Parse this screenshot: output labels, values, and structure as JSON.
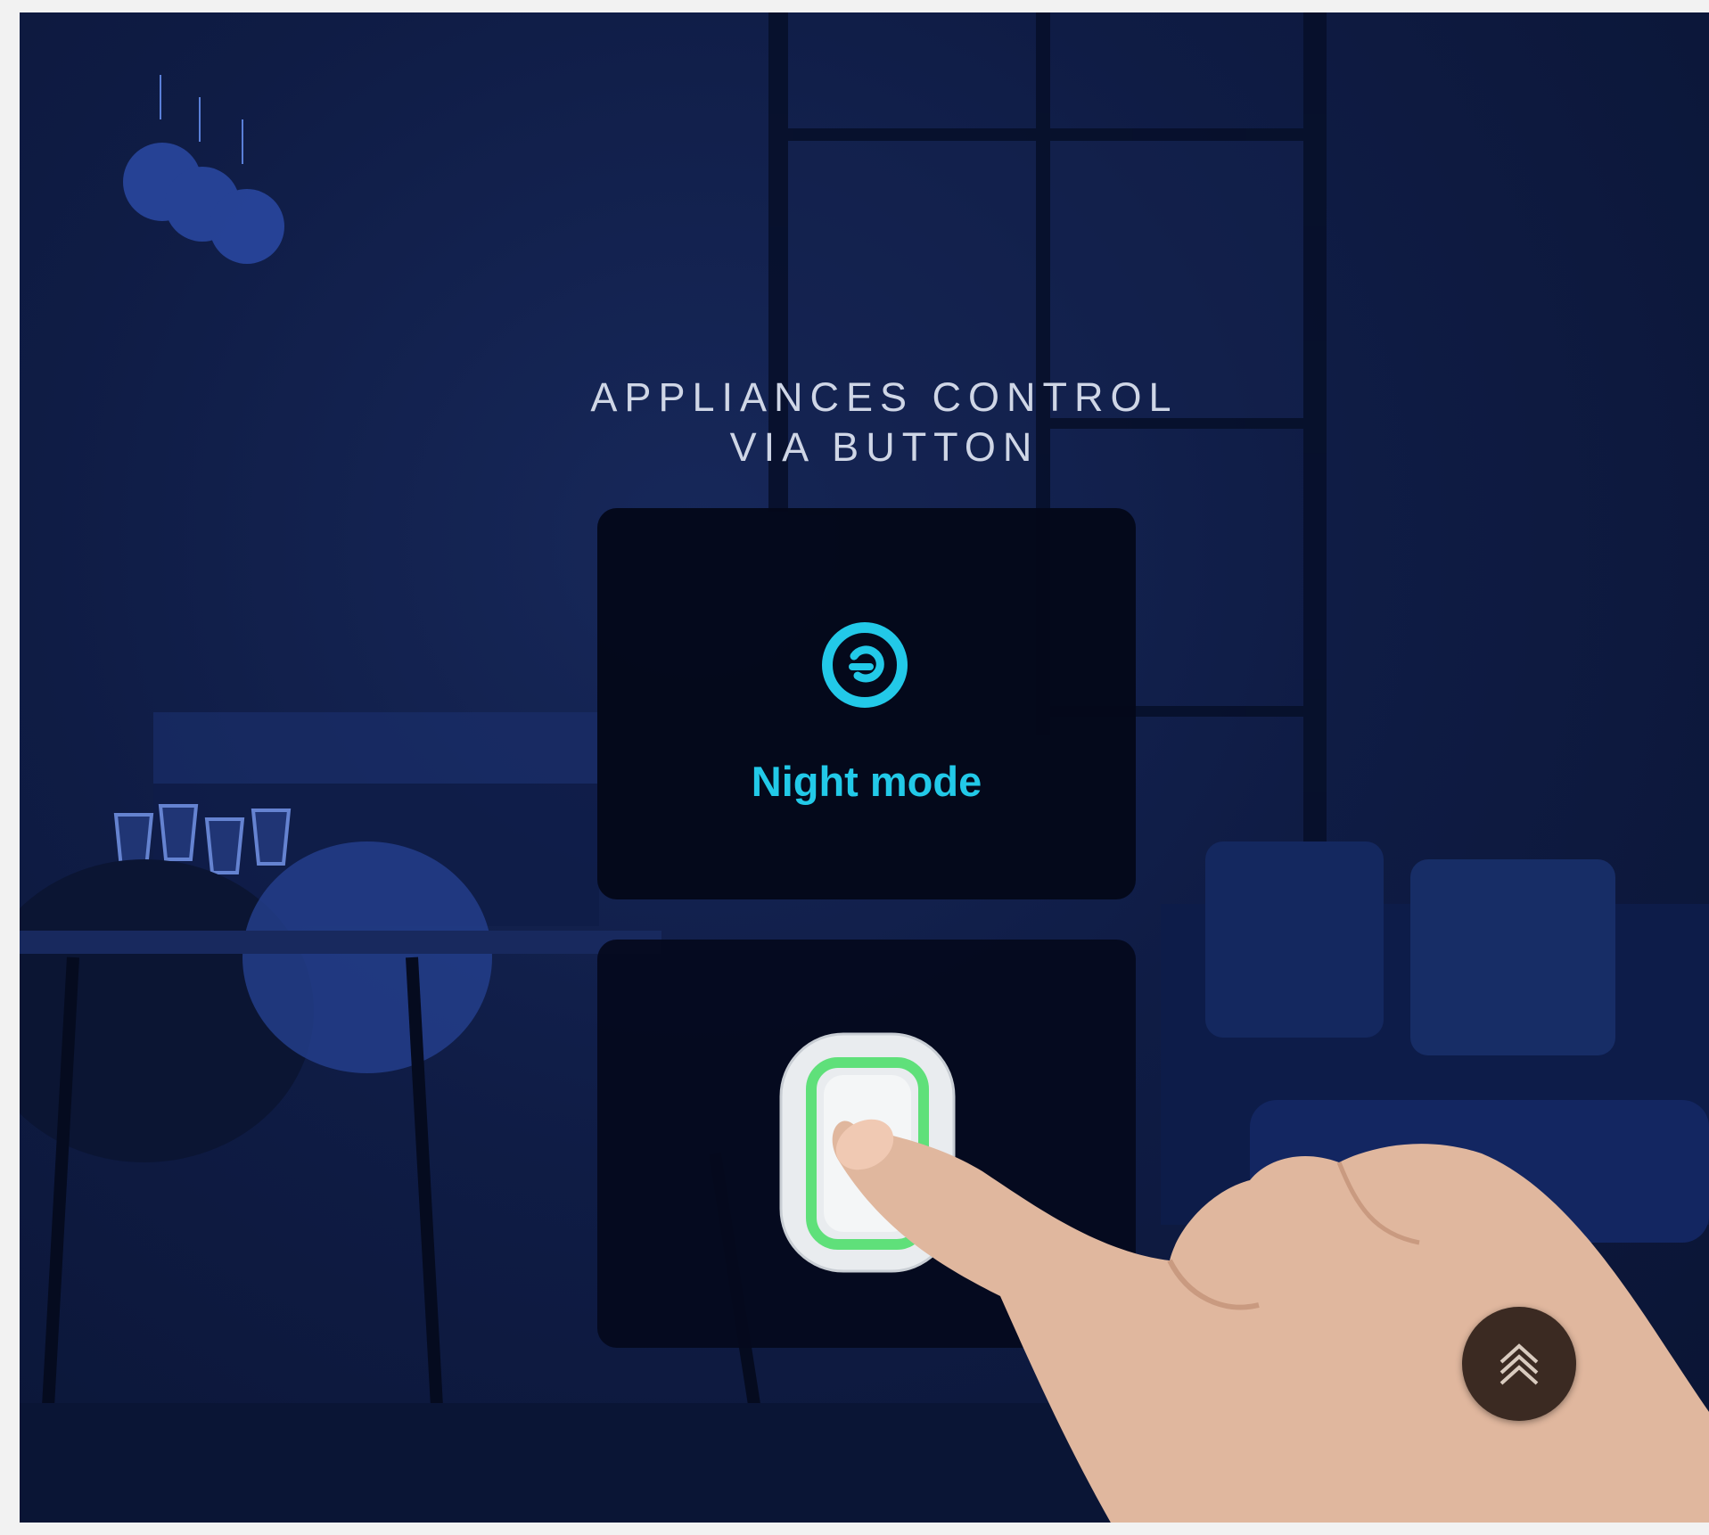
{
  "headline": {
    "line1": "APPLIANCES CONTROL",
    "line2": "VIA BUTTON"
  },
  "mode_card": {
    "label": "Night mode",
    "icon": "night-mode-icon",
    "accent_color": "#22c9e8"
  },
  "device": {
    "name": "smart-button",
    "ring_color": "#5fe07a"
  },
  "scroll_top_button": {
    "icon": "double-chevron-up-icon",
    "background_color": "#3b2a22"
  }
}
